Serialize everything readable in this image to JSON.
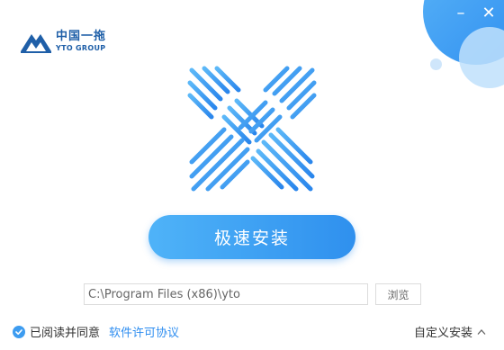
{
  "window": {
    "minimize_glyph": "–",
    "close_glyph": "✕",
    "accent_color": "#2f8ef0"
  },
  "logo": {
    "cn_text": "中国一拖",
    "en_text": "YTO GROUP",
    "icon": "mountain-logo-icon"
  },
  "hero": {
    "icon": "x-logo-icon"
  },
  "install": {
    "button_label": "极速安装"
  },
  "path": {
    "value": "C:\\Program Files (x86)\\yto",
    "browse_label": "浏览"
  },
  "footer": {
    "agree_checked": true,
    "agree_label": "已阅读并同意",
    "license_link": "软件许可协议",
    "custom_install_label": "自定义安装"
  }
}
